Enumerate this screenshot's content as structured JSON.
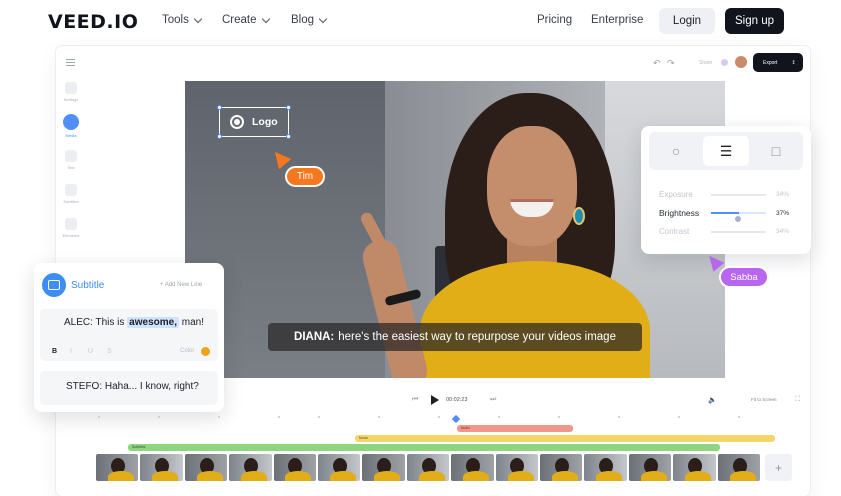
{
  "nav": {
    "logo": "VEED.IO",
    "tools": "Tools",
    "create": "Create",
    "blog": "Blog",
    "pricing": "Pricing",
    "enterprise": "Enterprise",
    "login": "Login",
    "signup": "Sign up"
  },
  "editor": {
    "topbar": {
      "share": "Share",
      "export": "Export"
    },
    "sidebar": [
      "Settings",
      "Media",
      "Text",
      "Subtitles",
      "Elements"
    ],
    "logo_overlay": "Logo",
    "collaborators": {
      "tim": "Tim",
      "sabba": "Sabba"
    },
    "caption": {
      "speaker": "DIANA:",
      "text": "here's the easiest way to repurpose your videos image"
    },
    "adjust": {
      "rows": [
        {
          "label": "Exposure",
          "value": "34%"
        },
        {
          "label": "Brightness",
          "value": "37%"
        },
        {
          "label": "Contrast",
          "value": "34%"
        }
      ]
    },
    "subtitle_panel": {
      "title": "Subtitle",
      "add_line": "+ Add New Line",
      "line1_pre": "ALEC: This is ",
      "line1_highlight": "awesome,",
      "line1_post": " man!",
      "format": {
        "bold": "B",
        "italic": "I",
        "underline": "U",
        "strike": "S",
        "color_label": "Color"
      },
      "line2": "STEFO: Haha... I know, right?"
    },
    "player": {
      "time": "00:02:23",
      "fit": "Fit to Screen"
    },
    "timeline": {
      "tracks": {
        "red": "Audio",
        "yellow": "Music",
        "green": "Subtitles"
      }
    },
    "colors": {
      "accent": "#4f8ff7",
      "tim": "#f6781e",
      "sabba": "#b866ee",
      "dark": "#12141d"
    }
  }
}
